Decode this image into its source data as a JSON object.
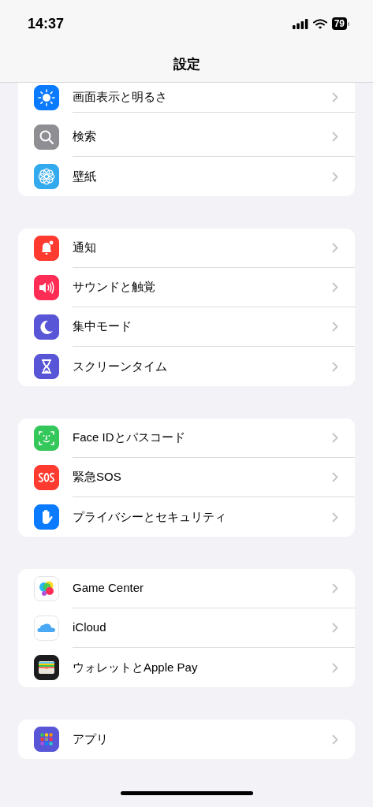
{
  "status_bar": {
    "time": "14:37",
    "battery": "79"
  },
  "title": "設定",
  "groups": [
    {
      "items": [
        {
          "label": "画面表示と明るさ"
        },
        {
          "label": "検索"
        },
        {
          "label": "壁紙"
        }
      ]
    },
    {
      "items": [
        {
          "label": "通知"
        },
        {
          "label": "サウンドと触覚"
        },
        {
          "label": "集中モード"
        },
        {
          "label": "スクリーンタイム"
        }
      ]
    },
    {
      "items": [
        {
          "label": "Face IDとパスコード"
        },
        {
          "label": "緊急SOS"
        },
        {
          "label": "プライバシーとセキュリティ"
        }
      ]
    },
    {
      "items": [
        {
          "label": "Game Center"
        },
        {
          "label": "iCloud"
        },
        {
          "label": "ウォレットとApple Pay"
        }
      ]
    },
    {
      "items": [
        {
          "label": "アプリ"
        }
      ]
    }
  ]
}
